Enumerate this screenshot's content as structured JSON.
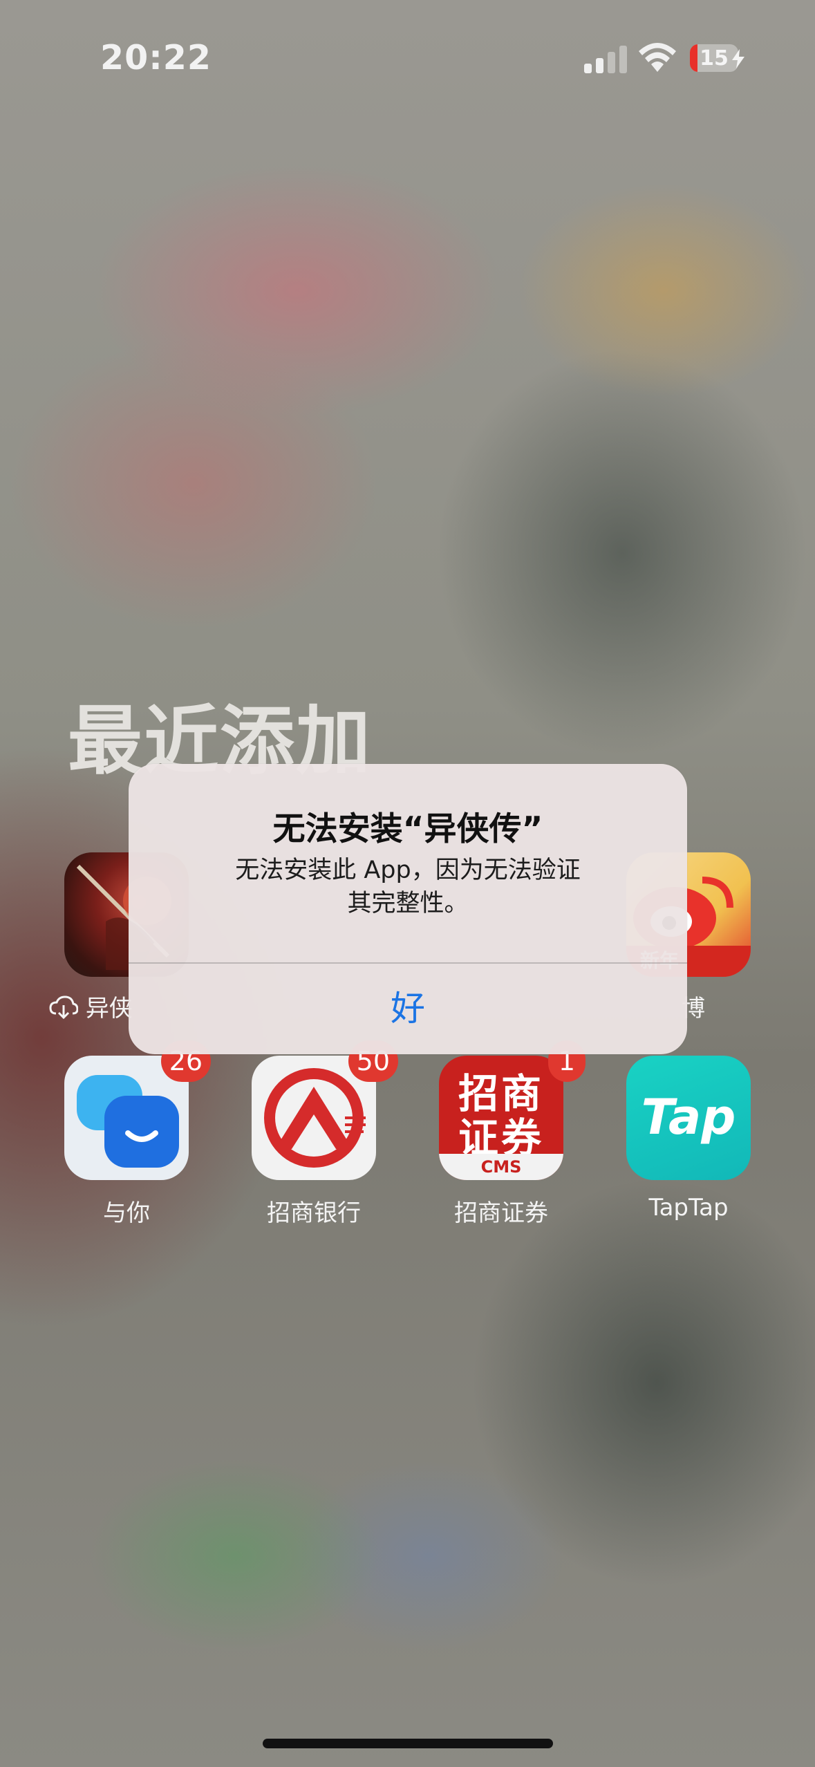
{
  "status_bar": {
    "time": "20:22",
    "battery_percent": "15",
    "battery_level": 0.15,
    "battery_color": "#e8302a",
    "icons": [
      "cellular-signal-icon",
      "wifi-icon",
      "battery-charging-icon"
    ]
  },
  "section": {
    "title": "最近添加"
  },
  "apps_row1": [
    {
      "label": "异侠",
      "icon": "yixiazhuan-app-icon",
      "downloading": true
    },
    {
      "label": "博",
      "icon": "weibo-app-icon"
    }
  ],
  "apps_row2": [
    {
      "label": "与你",
      "icon": "yuni-app-icon",
      "badge": "26"
    },
    {
      "label": "招商银行",
      "icon": "cmb-app-icon",
      "badge": "50"
    },
    {
      "label": "招商证券",
      "icon": "cms-app-icon",
      "badge": "1",
      "icon_text_top": "招商",
      "icon_text_bottom": "证券",
      "icon_subtext": "CMS"
    },
    {
      "label": "TapTap",
      "icon": "taptap-app-icon",
      "icon_text": "Tap"
    }
  ],
  "weibo_icon_text": "新年",
  "alert": {
    "title": "无法安装“异侠传”",
    "message": "无法安装此 App，因为无法验证其完整性。",
    "message_line1": "无法安装此 App，因为无法验证",
    "message_line2": "其完整性。",
    "ok_button": "好",
    "accent_color": "#1b74e4"
  }
}
